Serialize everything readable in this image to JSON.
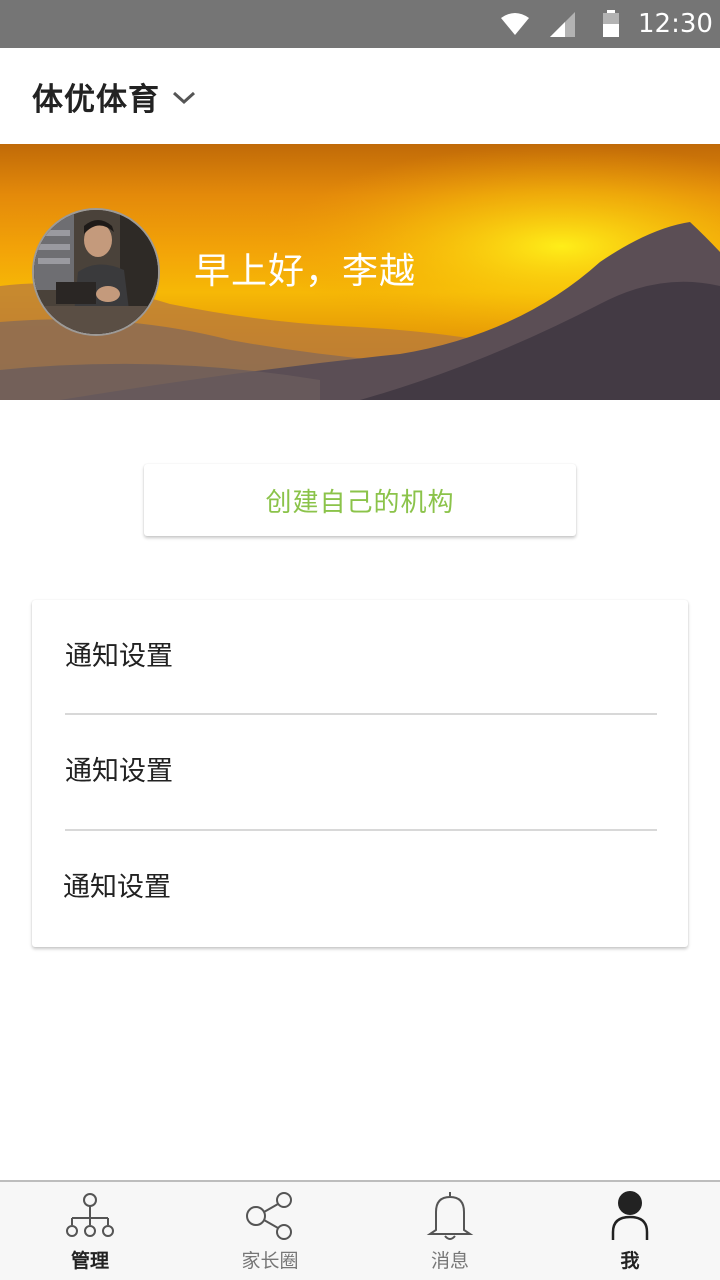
{
  "status_bar": {
    "time": "12:30",
    "icons": [
      "wifi-icon",
      "signal-icon",
      "battery-icon"
    ]
  },
  "app_bar": {
    "org_name": "体优体育",
    "dropdown_icon": "chevron-down-icon"
  },
  "banner": {
    "greeting": "早上好，李越",
    "avatar": "user-avatar"
  },
  "create_button": {
    "label": "创建自己的机构"
  },
  "settings": {
    "items": [
      {
        "label": "通知设置"
      },
      {
        "label": "通知设置"
      },
      {
        "label": "通知设置"
      }
    ]
  },
  "bottom_nav": {
    "active": "我",
    "items": [
      {
        "label": "管理",
        "icon": "org-chart-icon"
      },
      {
        "label": "家长圈",
        "icon": "share-icon"
      },
      {
        "label": "消息",
        "icon": "bell-icon"
      },
      {
        "label": "我",
        "icon": "person-icon"
      }
    ]
  },
  "colors": {
    "status_bar": "#757575",
    "accent_green": "#8bc34a",
    "banner_orange": "#f3a408",
    "text_dark": "#222222",
    "nav_inactive": "#777777"
  }
}
